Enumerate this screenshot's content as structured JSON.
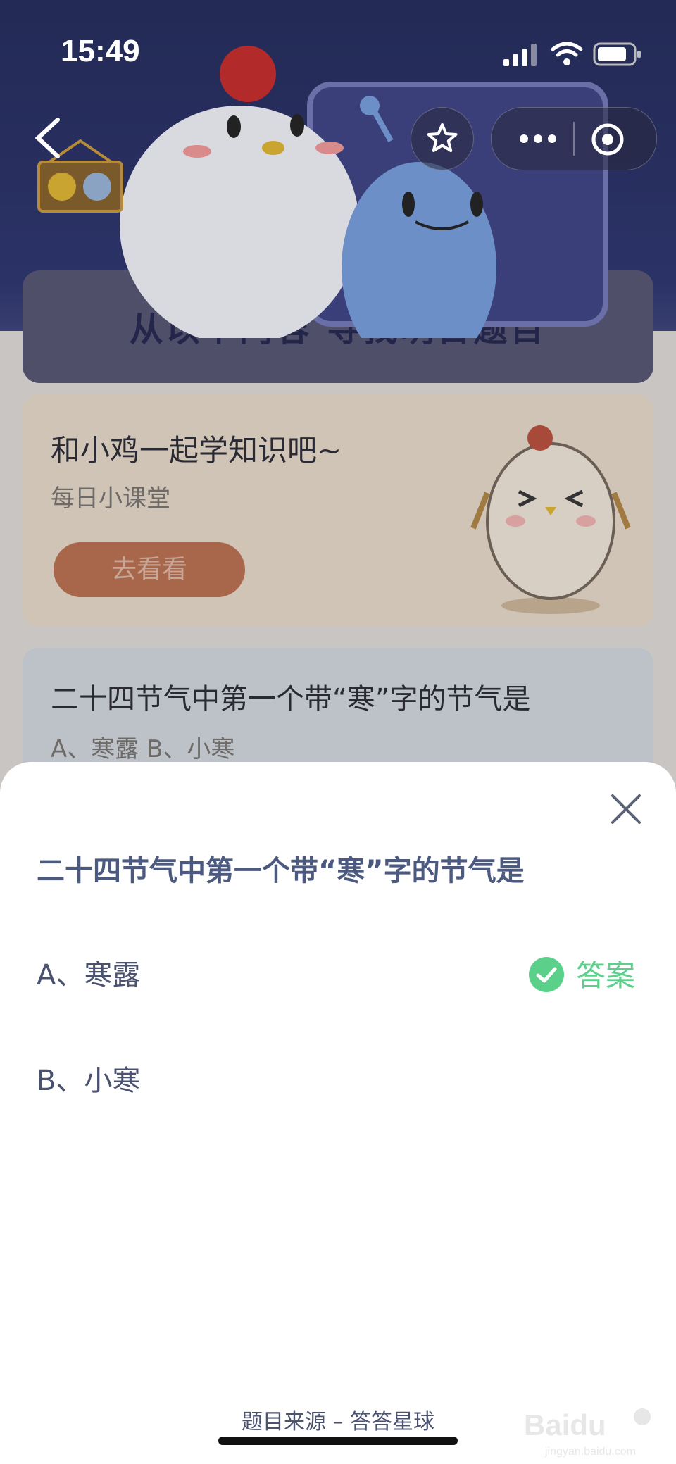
{
  "status_bar": {
    "time": "15:49"
  },
  "nav": {
    "back_icon": "chevron-left-icon",
    "star_icon": "star-icon",
    "more_icon": "more-dots-icon",
    "target_icon": "target-icon"
  },
  "section": {
    "title": "从以下内容  寻找明日题目"
  },
  "card_lesson": {
    "title": "和小鸡一起学知识吧~",
    "subtitle": "每日小课堂",
    "button": "去看看"
  },
  "card_question": {
    "question": "二十四节气中第一个带“寒”字的节气是",
    "options_line": "A、寒露     B、小寒"
  },
  "sheet": {
    "question": "二十四节气中第一个带“寒”字的节气是",
    "options": [
      {
        "label": "A、寒露",
        "is_answer": true
      },
      {
        "label": "B、小寒",
        "is_answer": false
      }
    ],
    "answer_label": "答案",
    "source": "题目来源 – 答答星球"
  },
  "colors": {
    "answer_green": "#5ad08a",
    "question_text": "#4c5a80",
    "header_bg": "#232a55"
  }
}
